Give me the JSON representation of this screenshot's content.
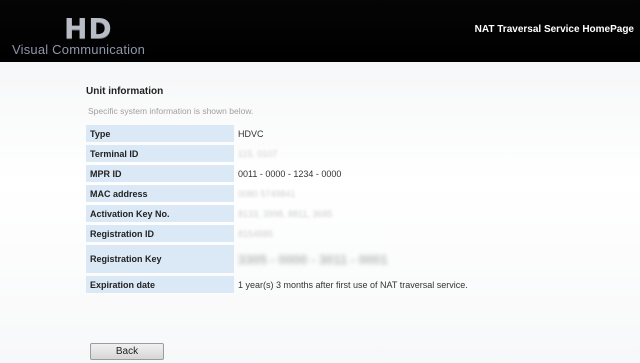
{
  "header": {
    "logo_text": "HD",
    "logo_subtitle": "Visual Communication",
    "homepage_link": "NAT Traversal Service HomePage"
  },
  "main": {
    "title": "Unit information",
    "description": "Specific system information is shown below.",
    "rows": [
      {
        "label": "Type",
        "value": "HDVC"
      },
      {
        "label": "Terminal ID",
        "value": "115. 0107"
      },
      {
        "label": "MPR ID",
        "value": "0011 - 0000 - 1234 - 0000"
      },
      {
        "label": "MAC address",
        "value": "0080 5749841"
      },
      {
        "label": "Activation Key No.",
        "value": "8133, 3998, 8811, 3685"
      },
      {
        "label": "Registration ID",
        "value": "8154885"
      },
      {
        "label": "Registration Key",
        "value": "3305 - 0000 - 3011 - 0001"
      },
      {
        "label": "Expiration date",
        "value": "1 year(s) 3 months after first use of NAT traversal service."
      }
    ],
    "back_button": "Back"
  }
}
